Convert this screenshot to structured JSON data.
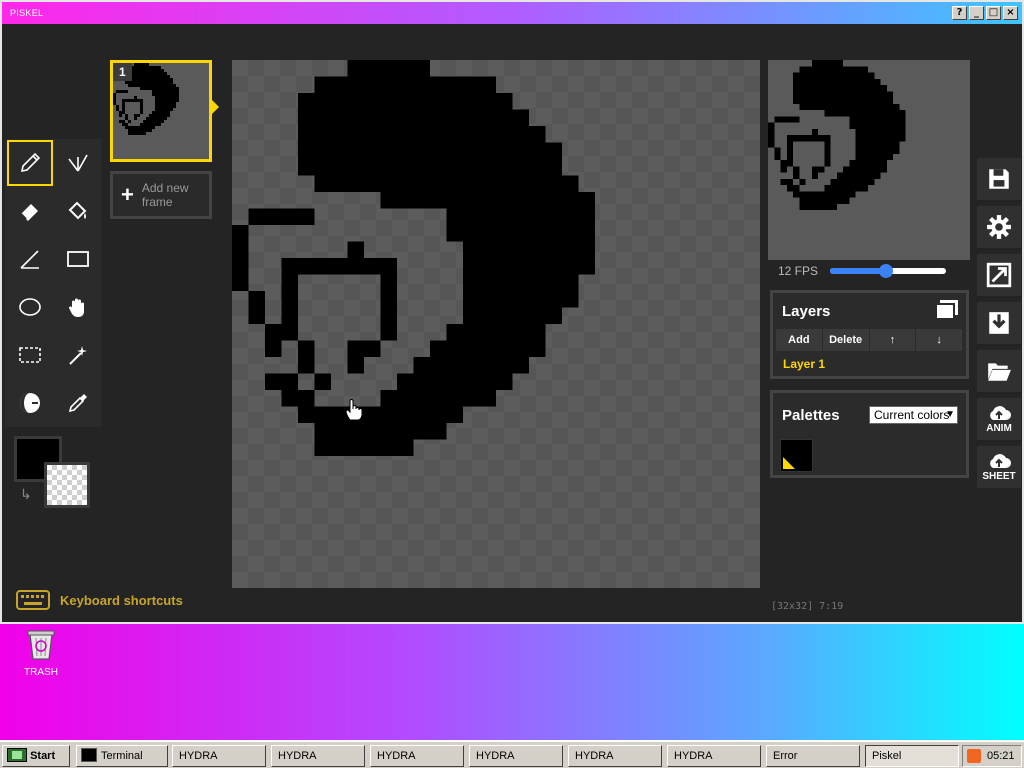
{
  "window": {
    "title": "PISKEL",
    "controls": [
      "?",
      "_",
      "□",
      "×"
    ]
  },
  "tools": [
    {
      "name": "pen-tool",
      "icon": "pencil-icon",
      "selected": true
    },
    {
      "name": "vertical-mirror-pen-tool",
      "icon": "mirror-pen-icon"
    },
    {
      "name": "eraser-tool",
      "icon": "eraser-icon"
    },
    {
      "name": "paint-bucket-tool",
      "icon": "bucket-icon"
    },
    {
      "name": "stroke-tool",
      "icon": "stroke-icon"
    },
    {
      "name": "rectangle-tool",
      "icon": "rectangle-icon"
    },
    {
      "name": "circle-tool",
      "icon": "circle-icon"
    },
    {
      "name": "move-tool",
      "icon": "hand-icon"
    },
    {
      "name": "rectangle-select-tool",
      "icon": "dashed-rectangle-icon"
    },
    {
      "name": "magic-wand-tool",
      "icon": "wand-icon"
    },
    {
      "name": "lighten-tool",
      "icon": "lighten-icon"
    },
    {
      "name": "color-picker-tool",
      "icon": "eyedropper-icon"
    }
  ],
  "colors": {
    "primary": "#000000",
    "secondary": "transparent",
    "accent": "#ffd700"
  },
  "shortcuts_label": "Keyboard shortcuts",
  "frames": {
    "items": [
      {
        "number": "1"
      }
    ],
    "add_label": "Add new frame"
  },
  "status": "[32x32] 7:19",
  "preview": {
    "fps_label": "12 FPS",
    "fps": 12
  },
  "layers": {
    "title": "Layers",
    "buttons": [
      "Add",
      "Delete",
      "↑",
      "↓"
    ],
    "items": [
      "Layer 1"
    ]
  },
  "palettes": {
    "title": "Palettes",
    "selected": "Current colors"
  },
  "side_buttons": [
    {
      "name": "save-button",
      "icon": "save-icon"
    },
    {
      "name": "settings-button",
      "icon": "gear-icon"
    },
    {
      "name": "resize-button",
      "icon": "resize-icon"
    },
    {
      "name": "export-button",
      "icon": "download-icon"
    },
    {
      "name": "open-button",
      "icon": "folder-icon"
    },
    {
      "name": "upload-anim-button",
      "icon": "cloud-upload-icon",
      "label": "ANIM"
    },
    {
      "name": "upload-sheet-button",
      "icon": "cloud-upload-icon",
      "label": "SHEET"
    }
  ],
  "desktop": {
    "trash_label": "TRASH"
  },
  "taskbar": {
    "start": "Start",
    "items": [
      "Terminal",
      "HYDRA",
      "HYDRA",
      "HYDRA",
      "HYDRA",
      "HYDRA",
      "HYDRA",
      "Error",
      "Piskel"
    ],
    "clock": "05:21"
  }
}
